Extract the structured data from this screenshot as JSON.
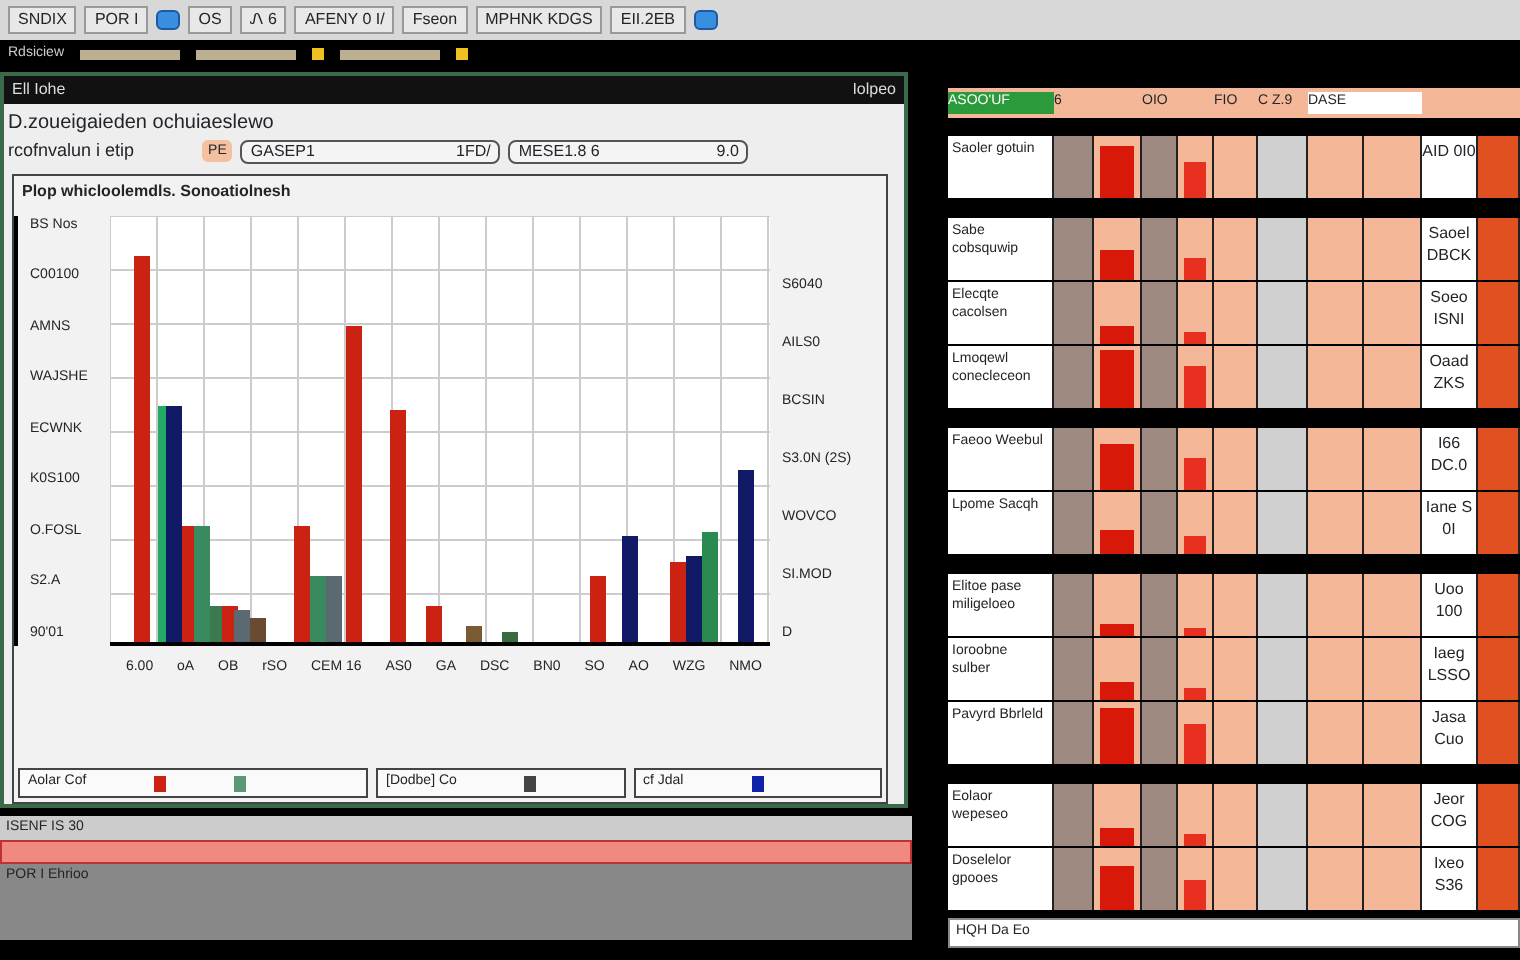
{
  "toolbar": [
    {
      "kind": "button",
      "label": "SNDIX"
    },
    {
      "kind": "button",
      "label": "POR I"
    },
    {
      "kind": "icon"
    },
    {
      "kind": "button",
      "label": "OS"
    },
    {
      "kind": "button",
      "label": "Ꮑ 6"
    },
    {
      "kind": "button",
      "label": "AFENY 0 I/"
    },
    {
      "kind": "button",
      "label": "Fseon"
    },
    {
      "kind": "button",
      "label": "MPHNK KDGS"
    },
    {
      "kind": "button",
      "label": "EII.2EB"
    },
    {
      "kind": "icon"
    }
  ],
  "strip": {
    "label": "Rdsiciew"
  },
  "window": {
    "title": "Ell Iohe",
    "corner": "Iolpeo",
    "heading": "D.zoueigaieden ochuiaeslewo",
    "field_label": "rcofnvalun i etip",
    "field_button": "PE",
    "field_1": {
      "value": "GASEP1",
      "suffix": "1FD/"
    },
    "field_2": {
      "value": "MESE1.8 6",
      "suffix": "9.0"
    }
  },
  "chart": {
    "title": "Plop whicloolemdls. Sonoatiolnesh",
    "left_ticks": [
      "BS Nos",
      "C00100",
      "AMNS",
      "WAJSHE",
      "ECWNK",
      "K0S100",
      "O.FOSL",
      "S2.A",
      "90'01"
    ],
    "right_ticks": [
      "S6040",
      "AILS0",
      "BCSIN",
      "S3.0N (2S)",
      "WOVCO",
      "SI.MOD",
      "D"
    ],
    "x_labels": [
      "6.00",
      "oA",
      "OB",
      "rSO",
      "CEM 16",
      "AS0",
      "GA",
      "DSC",
      "BN0",
      "SO",
      "AO",
      "WZG",
      "NMO"
    ]
  },
  "legend": [
    {
      "label": "Aolar Cof",
      "swatches": [
        {
          "color": "#cc2211"
        },
        {
          "color": "#5a9a70"
        }
      ]
    },
    {
      "label": "[Dodbe] Co",
      "swatches": [
        {
          "color": "#444444"
        }
      ]
    },
    {
      "label": "cf Jdal",
      "swatches": [
        {
          "color": "#1122aa"
        }
      ]
    }
  ],
  "taskbar": {
    "label": "ISENF IS 30",
    "status": "POR I Ehrioo"
  },
  "table": {
    "header": [
      "ASOO'UF",
      "6",
      "OIO",
      "FIO",
      "C Z.9",
      "DASE"
    ],
    "groups": [
      {
        "rows": [
          {
            "label": "Saoler gotuin",
            "value": "AID 0I0",
            "level": 0.85
          }
        ]
      },
      {
        "rows": [
          {
            "label": "Sabe cobsquwip",
            "value": "Saoel DBCK",
            "level": 0.5
          },
          {
            "label": "Elecqte cacolsen",
            "value": "Soeo ISNI",
            "level": 0.3
          },
          {
            "label": "Lmoqewl conecleceon",
            "value": "Oaad ZKS",
            "level": 0.95
          }
        ]
      },
      {
        "rows": [
          {
            "label": "Faeoo Weebul",
            "value": "I66 DC.0",
            "level": 0.75
          },
          {
            "label": "Lpome Sacqh",
            "value": "Iane S 0I",
            "level": 0.4
          }
        ]
      },
      {
        "rows": [
          {
            "label": "Elitoe pase miligeloeo",
            "value": "Uoo 100",
            "level": 0.2
          },
          {
            "label": "Ioroobne sulber",
            "value": "Iaeg LSSO",
            "level": 0.3
          },
          {
            "label": "Pavyrd Bbrleld",
            "value": "Jasa Cuo",
            "level": 0.9
          }
        ]
      },
      {
        "rows": [
          {
            "label": "Eolaor wepeseo",
            "value": "Jeor COG",
            "level": 0.3
          },
          {
            "label": "Doselelor gpooes",
            "value": "Ixeo S36",
            "level": 0.7
          }
        ]
      }
    ],
    "footer": "HQH Da Eo"
  }
}
